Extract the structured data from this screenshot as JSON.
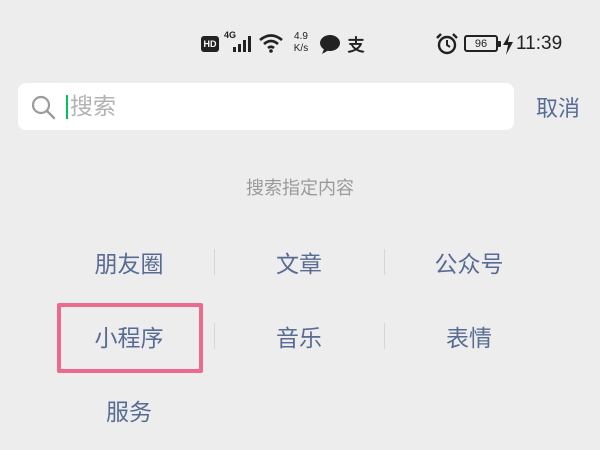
{
  "status_bar": {
    "hd": "HD",
    "network": "4G",
    "speed_value": "4.9",
    "speed_unit": "K/s",
    "alipay_glyph": "支",
    "battery": "96",
    "time": "11:39",
    "icons": [
      "signal-icon",
      "wifi-icon",
      "chat-bubble-icon",
      "alipay-icon",
      "alarm-icon",
      "charging-bolt-icon"
    ]
  },
  "search": {
    "placeholder": "搜索",
    "value": "",
    "cancel_label": "取消",
    "accent_color": "#07c160"
  },
  "section": {
    "title": "搜索指定内容"
  },
  "options": [
    {
      "label": "朋友圈"
    },
    {
      "label": "文章"
    },
    {
      "label": "公众号"
    },
    {
      "label": "小程序",
      "highlighted": true
    },
    {
      "label": "音乐"
    },
    {
      "label": "表情"
    },
    {
      "label": "服务"
    }
  ],
  "colors": {
    "background": "#ededed",
    "link": "#576b95",
    "highlight": "#ec6a8d",
    "muted_text": "#9a9a9a"
  }
}
